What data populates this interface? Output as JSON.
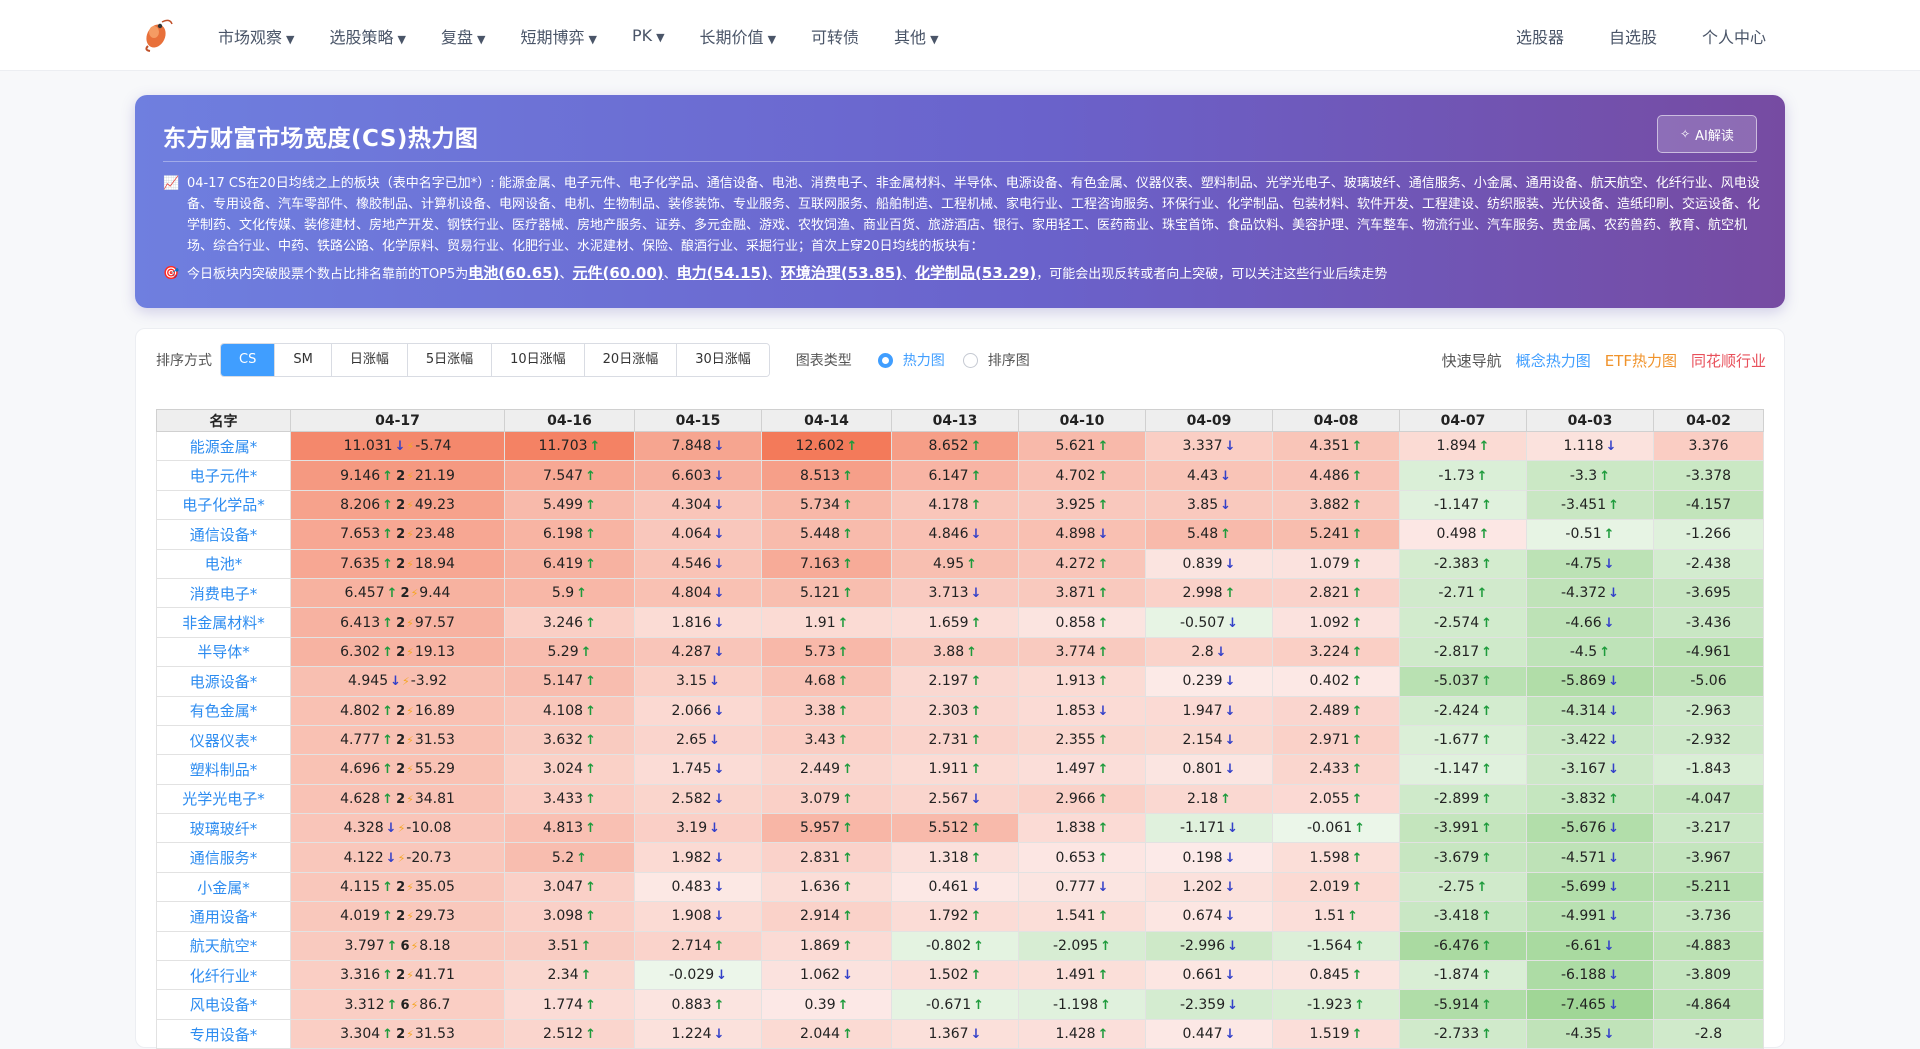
{
  "nav": {
    "menu": [
      {
        "label": "市场观察",
        "caret": true
      },
      {
        "label": "选股策略",
        "caret": true
      },
      {
        "label": "复盘",
        "caret": true
      },
      {
        "label": "短期博弈",
        "caret": true
      },
      {
        "label": "PK",
        "caret": true
      },
      {
        "label": "长期价值",
        "caret": true
      },
      {
        "label": "可转债",
        "caret": false
      },
      {
        "label": "其他",
        "caret": true
      }
    ],
    "right": [
      "选股器",
      "自选股",
      "个人中心"
    ]
  },
  "hero": {
    "title": "东方财富市场宽度(CS)热力图",
    "ai_button": "AI解读",
    "para1_icon": "📈",
    "para1": "04-17 CS在20日均线之上的板块（表中名字已加*）: 能源金属、电子元件、电子化学品、通信设备、电池、消费电子、非金属材料、半导体、电源设备、有色金属、仪器仪表、塑料制品、光学光电子、玻璃玻纤、通信服务、小金属、通用设备、航天航空、化纤行业、风电设备、专用设备、汽车零部件、橡胶制品、计算机设备、电网设备、电机、生物制品、装修装饰、专业服务、互联网服务、船舶制造、工程机械、家电行业、工程咨询服务、环保行业、化学制品、包装材料、软件开发、工程建设、纺织服装、光伏设备、造纸印刷、交运设备、化学制药、文化传媒、装修建材、房地产开发、钢铁行业、医疗器械、房地产服务、证券、多元金融、游戏、农牧饲渔、商业百货、旅游酒店、银行、家用轻工、医药商业、珠宝首饰、食品饮料、美容护理、汽车整车、物流行业、汽车服务、贵金属、农药兽药、教育、航空机场、综合行业、中药、铁路公路、化学原料、贸易行业、化肥行业、水泥建材、保险、酿酒行业、采掘行业；首次上穿20日均线的板块有：",
    "para2_icon": "🎯",
    "para2_prefix": "今日板块内突破股票个数占比排名靠前的TOP5为",
    "top5": [
      "电池(60.65)",
      "元件(60.00)",
      "电力(54.15)",
      "环境治理(53.85)",
      "化学制品(53.29)"
    ],
    "top5_sep": "、",
    "para2_suffix": "，可能会出现反转或者向上突破，可以关注这些行业后续走势"
  },
  "toolbar": {
    "sort_label": "排序方式",
    "sort_options": [
      "CS",
      "SM",
      "日涨幅",
      "5日涨幅",
      "10日涨幅",
      "20日涨幅",
      "30日涨幅"
    ],
    "sort_active": 0,
    "chart_label": "图表类型",
    "chart_options": [
      "热力图",
      "排序图"
    ],
    "chart_active": 0,
    "quick_label": "快速导航",
    "quick_links": [
      {
        "label": "概念热力图",
        "color": "#409eff"
      },
      {
        "label": "ETF热力图",
        "color": "#f0932b"
      },
      {
        "label": "同花顺行业",
        "color": "#e8505b"
      }
    ]
  },
  "table": {
    "headers": [
      "名字",
      "04-17",
      "04-16",
      "04-15",
      "04-14",
      "04-13",
      "04-10",
      "04-09",
      "04-08",
      "04-07",
      "04-03",
      "04-02"
    ],
    "rows": [
      {
        "name": "能源金属*",
        "cells": [
          [
            "11.031",
            "d"
          ],
          [
            "11.703",
            "u"
          ],
          [
            "7.848",
            "d"
          ],
          [
            "12.602",
            "u"
          ],
          [
            "8.652",
            "u"
          ],
          [
            "5.621",
            "u"
          ],
          [
            "3.337",
            "d"
          ],
          [
            "4.351",
            "u"
          ],
          [
            "1.894",
            "u"
          ],
          [
            "1.118",
            "d"
          ],
          [
            "3.376",
            ""
          ]
        ],
        "cnt": "",
        "bolt": true,
        "sm": "-5.74"
      },
      {
        "name": "电子元件*",
        "cells": [
          [
            "9.146",
            "u"
          ],
          [
            "7.547",
            "u"
          ],
          [
            "6.603",
            "d"
          ],
          [
            "8.513",
            "u"
          ],
          [
            "6.147",
            "u"
          ],
          [
            "4.702",
            "u"
          ],
          [
            "4.43",
            "d"
          ],
          [
            "4.486",
            "u"
          ],
          [
            "-1.73",
            "u"
          ],
          [
            "-3.3",
            "u"
          ],
          [
            "-3.378",
            ""
          ]
        ],
        "cnt": "2",
        "bolt": false,
        "sm": "21.19"
      },
      {
        "name": "电子化学品*",
        "cells": [
          [
            "8.206",
            "u"
          ],
          [
            "5.499",
            "u"
          ],
          [
            "4.304",
            "d"
          ],
          [
            "5.734",
            "u"
          ],
          [
            "4.178",
            "u"
          ],
          [
            "3.925",
            "u"
          ],
          [
            "3.85",
            "d"
          ],
          [
            "3.882",
            "u"
          ],
          [
            "-1.147",
            "u"
          ],
          [
            "-3.451",
            "u"
          ],
          [
            "-4.157",
            ""
          ]
        ],
        "cnt": "2",
        "bolt": false,
        "sm": "49.23"
      },
      {
        "name": "通信设备*",
        "cells": [
          [
            "7.653",
            "u"
          ],
          [
            "6.198",
            "u"
          ],
          [
            "4.064",
            "d"
          ],
          [
            "5.448",
            "u"
          ],
          [
            "4.846",
            "d"
          ],
          [
            "4.898",
            "d"
          ],
          [
            "5.48",
            "u"
          ],
          [
            "5.241",
            "u"
          ],
          [
            "0.498",
            "u"
          ],
          [
            "-0.51",
            "u"
          ],
          [
            "-1.266",
            ""
          ]
        ],
        "cnt": "2",
        "bolt": false,
        "sm": "23.48"
      },
      {
        "name": "电池*",
        "cells": [
          [
            "7.635",
            "u"
          ],
          [
            "6.419",
            "u"
          ],
          [
            "4.546",
            "d"
          ],
          [
            "7.163",
            "u"
          ],
          [
            "4.95",
            "u"
          ],
          [
            "4.272",
            "u"
          ],
          [
            "0.839",
            "d"
          ],
          [
            "1.079",
            "u"
          ],
          [
            "-2.383",
            "u"
          ],
          [
            "-4.75",
            "d"
          ],
          [
            "-2.438",
            ""
          ]
        ],
        "cnt": "2",
        "bolt": false,
        "sm": "18.94"
      },
      {
        "name": "消费电子*",
        "cells": [
          [
            "6.457",
            "u"
          ],
          [
            "5.9",
            "u"
          ],
          [
            "4.804",
            "d"
          ],
          [
            "5.121",
            "u"
          ],
          [
            "3.713",
            "d"
          ],
          [
            "3.871",
            "u"
          ],
          [
            "2.998",
            "u"
          ],
          [
            "2.821",
            "u"
          ],
          [
            "-2.71",
            "u"
          ],
          [
            "-4.372",
            "d"
          ],
          [
            "-3.695",
            ""
          ]
        ],
        "cnt": "2",
        "bolt": false,
        "sm": "9.44"
      },
      {
        "name": "非金属材料*",
        "cells": [
          [
            "6.413",
            "u"
          ],
          [
            "3.246",
            "u"
          ],
          [
            "1.816",
            "d"
          ],
          [
            "1.91",
            "u"
          ],
          [
            "1.659",
            "u"
          ],
          [
            "0.858",
            "u"
          ],
          [
            "-0.507",
            "d"
          ],
          [
            "1.092",
            "u"
          ],
          [
            "-2.574",
            "u"
          ],
          [
            "-4.66",
            "d"
          ],
          [
            "-3.436",
            ""
          ]
        ],
        "cnt": "2",
        "bolt": false,
        "sm": "97.57"
      },
      {
        "name": "半导体*",
        "cells": [
          [
            "6.302",
            "u"
          ],
          [
            "5.29",
            "u"
          ],
          [
            "4.287",
            "d"
          ],
          [
            "5.73",
            "u"
          ],
          [
            "3.88",
            "u"
          ],
          [
            "3.774",
            "u"
          ],
          [
            "2.8",
            "d"
          ],
          [
            "3.224",
            "u"
          ],
          [
            "-2.817",
            "u"
          ],
          [
            "-4.5",
            "u"
          ],
          [
            "-4.961",
            ""
          ]
        ],
        "cnt": "2",
        "bolt": false,
        "sm": "19.13"
      },
      {
        "name": "电源设备*",
        "cells": [
          [
            "4.945",
            "d"
          ],
          [
            "5.147",
            "u"
          ],
          [
            "3.15",
            "d"
          ],
          [
            "4.68",
            "u"
          ],
          [
            "2.197",
            "u"
          ],
          [
            "1.913",
            "u"
          ],
          [
            "0.239",
            "d"
          ],
          [
            "0.402",
            "u"
          ],
          [
            "-5.037",
            "u"
          ],
          [
            "-5.869",
            "d"
          ],
          [
            "-5.06",
            ""
          ]
        ],
        "cnt": "",
        "bolt": true,
        "sm": "-3.92"
      },
      {
        "name": "有色金属*",
        "cells": [
          [
            "4.802",
            "u"
          ],
          [
            "4.108",
            "u"
          ],
          [
            "2.066",
            "d"
          ],
          [
            "3.38",
            "u"
          ],
          [
            "2.303",
            "u"
          ],
          [
            "1.853",
            "d"
          ],
          [
            "1.947",
            "d"
          ],
          [
            "2.489",
            "u"
          ],
          [
            "-2.424",
            "u"
          ],
          [
            "-4.314",
            "d"
          ],
          [
            "-2.963",
            ""
          ]
        ],
        "cnt": "2",
        "bolt": false,
        "sm": "16.89"
      },
      {
        "name": "仪器仪表*",
        "cells": [
          [
            "4.777",
            "u"
          ],
          [
            "3.632",
            "u"
          ],
          [
            "2.65",
            "d"
          ],
          [
            "3.43",
            "u"
          ],
          [
            "2.731",
            "u"
          ],
          [
            "2.355",
            "u"
          ],
          [
            "2.154",
            "d"
          ],
          [
            "2.971",
            "u"
          ],
          [
            "-1.677",
            "u"
          ],
          [
            "-3.422",
            "d"
          ],
          [
            "-2.932",
            ""
          ]
        ],
        "cnt": "2",
        "bolt": false,
        "sm": "31.53"
      },
      {
        "name": "塑料制品*",
        "cells": [
          [
            "4.696",
            "u"
          ],
          [
            "3.024",
            "u"
          ],
          [
            "1.745",
            "d"
          ],
          [
            "2.449",
            "u"
          ],
          [
            "1.911",
            "u"
          ],
          [
            "1.497",
            "u"
          ],
          [
            "0.801",
            "d"
          ],
          [
            "2.433",
            "u"
          ],
          [
            "-1.147",
            "u"
          ],
          [
            "-3.167",
            "d"
          ],
          [
            "-1.843",
            ""
          ]
        ],
        "cnt": "2",
        "bolt": false,
        "sm": "55.29"
      },
      {
        "name": "光学光电子*",
        "cells": [
          [
            "4.628",
            "u"
          ],
          [
            "3.433",
            "u"
          ],
          [
            "2.582",
            "d"
          ],
          [
            "3.079",
            "u"
          ],
          [
            "2.567",
            "d"
          ],
          [
            "2.966",
            "u"
          ],
          [
            "2.18",
            "u"
          ],
          [
            "2.055",
            "u"
          ],
          [
            "-2.899",
            "u"
          ],
          [
            "-3.832",
            "u"
          ],
          [
            "-4.047",
            ""
          ]
        ],
        "cnt": "2",
        "bolt": false,
        "sm": "34.81"
      },
      {
        "name": "玻璃玻纤*",
        "cells": [
          [
            "4.328",
            "d"
          ],
          [
            "4.813",
            "u"
          ],
          [
            "3.19",
            "d"
          ],
          [
            "5.957",
            "u"
          ],
          [
            "5.512",
            "u"
          ],
          [
            "1.838",
            "u"
          ],
          [
            "-1.171",
            "d"
          ],
          [
            "-0.061",
            "u"
          ],
          [
            "-3.991",
            "u"
          ],
          [
            "-5.676",
            "d"
          ],
          [
            "-3.217",
            ""
          ]
        ],
        "cnt": "",
        "bolt": true,
        "sm": "-10.08"
      },
      {
        "name": "通信服务*",
        "cells": [
          [
            "4.122",
            "d"
          ],
          [
            "5.2",
            "u"
          ],
          [
            "1.982",
            "d"
          ],
          [
            "2.831",
            "u"
          ],
          [
            "1.318",
            "u"
          ],
          [
            "0.653",
            "u"
          ],
          [
            "0.198",
            "d"
          ],
          [
            "1.598",
            "u"
          ],
          [
            "-3.679",
            "u"
          ],
          [
            "-4.571",
            "d"
          ],
          [
            "-3.967",
            ""
          ]
        ],
        "cnt": "",
        "bolt": true,
        "sm": "-20.73"
      },
      {
        "name": "小金属*",
        "cells": [
          [
            "4.115",
            "u"
          ],
          [
            "3.047",
            "u"
          ],
          [
            "0.483",
            "d"
          ],
          [
            "1.636",
            "u"
          ],
          [
            "0.461",
            "d"
          ],
          [
            "0.777",
            "d"
          ],
          [
            "1.202",
            "d"
          ],
          [
            "2.019",
            "u"
          ],
          [
            "-2.75",
            "u"
          ],
          [
            "-5.699",
            "d"
          ],
          [
            "-5.211",
            ""
          ]
        ],
        "cnt": "2",
        "bolt": false,
        "sm": "35.05"
      },
      {
        "name": "通用设备*",
        "cells": [
          [
            "4.019",
            "u"
          ],
          [
            "3.098",
            "u"
          ],
          [
            "1.908",
            "d"
          ],
          [
            "2.914",
            "u"
          ],
          [
            "1.792",
            "u"
          ],
          [
            "1.541",
            "u"
          ],
          [
            "0.674",
            "d"
          ],
          [
            "1.51",
            "u"
          ],
          [
            "-3.418",
            "u"
          ],
          [
            "-4.991",
            "d"
          ],
          [
            "-3.736",
            ""
          ]
        ],
        "cnt": "2",
        "bolt": false,
        "sm": "29.73"
      },
      {
        "name": "航天航空*",
        "cells": [
          [
            "3.797",
            "u"
          ],
          [
            "3.51",
            "u"
          ],
          [
            "2.714",
            "u"
          ],
          [
            "1.869",
            "u"
          ],
          [
            "-0.802",
            "u"
          ],
          [
            "-2.095",
            "u"
          ],
          [
            "-2.996",
            "d"
          ],
          [
            "-1.564",
            "u"
          ],
          [
            "-6.476",
            "u"
          ],
          [
            "-6.61",
            "d"
          ],
          [
            "-4.883",
            ""
          ]
        ],
        "cnt": "6",
        "bolt": false,
        "sm": "8.18"
      },
      {
        "name": "化纤行业*",
        "cells": [
          [
            "3.316",
            "u"
          ],
          [
            "2.34",
            "u"
          ],
          [
            "-0.029",
            "d"
          ],
          [
            "1.062",
            "d"
          ],
          [
            "1.502",
            "u"
          ],
          [
            "1.491",
            "u"
          ],
          [
            "0.661",
            "d"
          ],
          [
            "0.845",
            "u"
          ],
          [
            "-1.874",
            "u"
          ],
          [
            "-6.188",
            "d"
          ],
          [
            "-3.809",
            ""
          ]
        ],
        "cnt": "2",
        "bolt": false,
        "sm": "41.71"
      },
      {
        "name": "风电设备*",
        "cells": [
          [
            "3.312",
            "u"
          ],
          [
            "1.774",
            "u"
          ],
          [
            "0.883",
            "u"
          ],
          [
            "0.39",
            "u"
          ],
          [
            "-0.671",
            "u"
          ],
          [
            "-1.198",
            "u"
          ],
          [
            "-2.359",
            "d"
          ],
          [
            "-1.923",
            "u"
          ],
          [
            "-5.914",
            "u"
          ],
          [
            "-7.465",
            "d"
          ],
          [
            "-4.864",
            ""
          ]
        ],
        "cnt": "6",
        "bolt": false,
        "sm": "86.7"
      },
      {
        "name": "专用设备*",
        "cells": [
          [
            "3.304",
            "u"
          ],
          [
            "2.512",
            "u"
          ],
          [
            "1.224",
            "d"
          ],
          [
            "2.044",
            "u"
          ],
          [
            "1.367",
            "d"
          ],
          [
            "1.428",
            "u"
          ],
          [
            "0.447",
            "d"
          ],
          [
            "1.519",
            "u"
          ],
          [
            "-2.733",
            "u"
          ],
          [
            "-4.35",
            "d"
          ],
          [
            "-2.8",
            ""
          ]
        ],
        "cnt": "2",
        "bolt": false,
        "sm": "31.53"
      }
    ]
  },
  "colors": {
    "accent": "#409eff",
    "up_arrow": "#1e9b3c",
    "down_arrow": "#3340c9",
    "hot": "#f37a5a",
    "cold": "#a8dba0"
  }
}
